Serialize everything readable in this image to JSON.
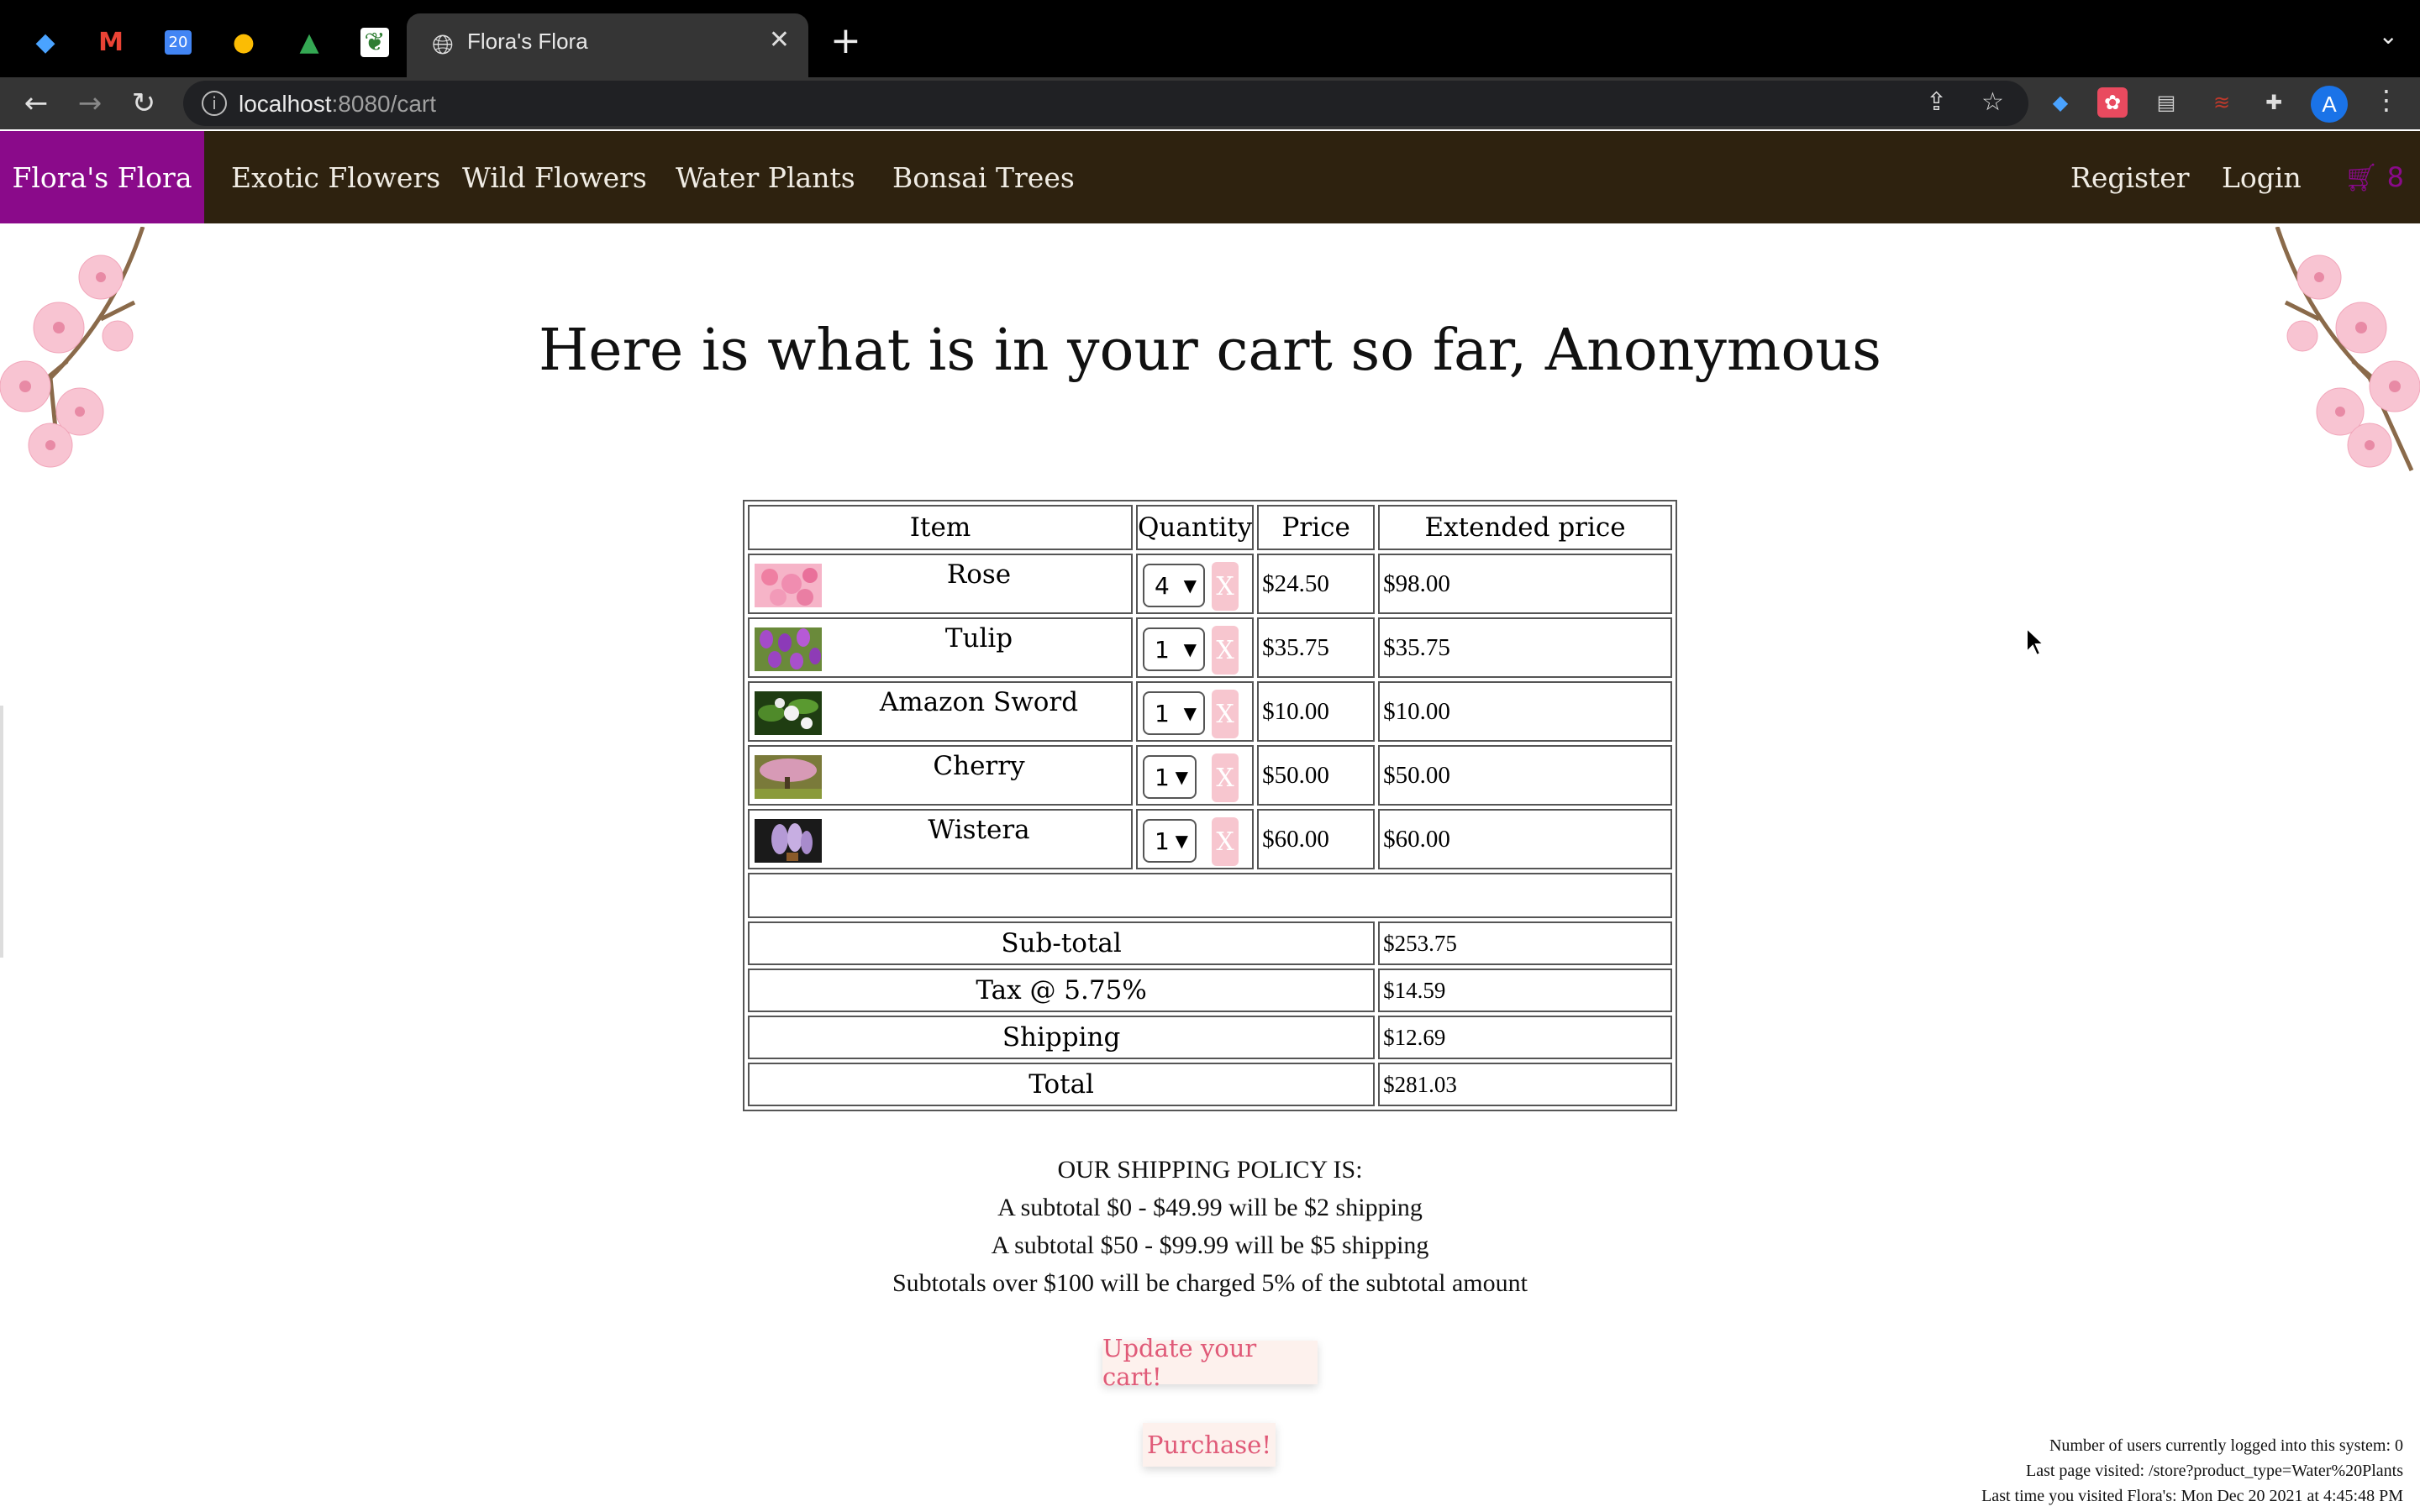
{
  "browser": {
    "pinned_tabs": [
      {
        "icon": "diamond-icon",
        "glyph": "◆",
        "color": "#4aa3ff"
      },
      {
        "icon": "gmail-icon",
        "glyph": "M",
        "color": "#ea4335"
      },
      {
        "icon": "calendar-icon",
        "glyph": "20",
        "color": "#4285f4"
      },
      {
        "icon": "keep-icon",
        "glyph": "●",
        "color": "#fbbc04"
      },
      {
        "icon": "drive-icon",
        "glyph": "▲",
        "color": "#34a853"
      },
      {
        "icon": "leaf-icon",
        "glyph": "❦",
        "color": "#2e7d32"
      }
    ],
    "active_tab_title": "Flora's Flora",
    "close_glyph": "✕",
    "new_tab_glyph": "+",
    "tab_menu_glyph": "⌄",
    "url_host": "localhost",
    "url_path": ":8080/cart",
    "avatar_letter": "A"
  },
  "nav": {
    "brand": "Flora's Flora",
    "links": [
      "Exotic Flowers",
      "Wild Flowers",
      "Water Plants",
      "Bonsai Trees"
    ],
    "register": "Register",
    "login": "Login",
    "cart_count": "8"
  },
  "page": {
    "heading": "Here is what is in your cart so far, Anonymous"
  },
  "cart": {
    "headers": {
      "item": "Item",
      "quantity": "Quantity",
      "price": "Price",
      "extended": "Extended price"
    },
    "items": [
      {
        "name": "Rose",
        "qty": "4",
        "price": "$24.50",
        "extended": "$98.00",
        "remove": "X"
      },
      {
        "name": "Tulip",
        "qty": "1",
        "price": "$35.75",
        "extended": "$35.75",
        "remove": "X"
      },
      {
        "name": "Amazon Sword",
        "qty": "1",
        "price": "$10.00",
        "extended": "$10.00",
        "remove": "X"
      },
      {
        "name": "Cherry",
        "qty": "1",
        "price": "$50.00",
        "extended": "$50.00",
        "remove": "X"
      },
      {
        "name": "Wistera",
        "qty": "1",
        "price": "$60.00",
        "extended": "$60.00",
        "remove": "X"
      }
    ],
    "summary": {
      "subtotal_label": "Sub-total",
      "subtotal": "$253.75",
      "tax_label": "Tax @ 5.75%",
      "tax": "$14.59",
      "shipping_label": "Shipping",
      "shipping": "$12.69",
      "total_label": "Total",
      "total": "$281.03"
    }
  },
  "policy": {
    "title": "OUR SHIPPING POLICY IS:",
    "lines": [
      "A subtotal $0 - $49.99 will be $2 shipping",
      "A subtotal $50 - $99.99 will be $5 shipping",
      "Subtotals over $100 will be charged 5% of the subtotal amount"
    ]
  },
  "buttons": {
    "update": "Update your cart!",
    "purchase": "Purchase!"
  },
  "footer": {
    "users": "Number of users currently logged into this system: 0",
    "last_page": "Last page visited: /store?product_type=Water%20Plants",
    "last_visit": "Last time you visited Flora's: Mon Dec 20 2021 at 4:45:48 PM"
  }
}
